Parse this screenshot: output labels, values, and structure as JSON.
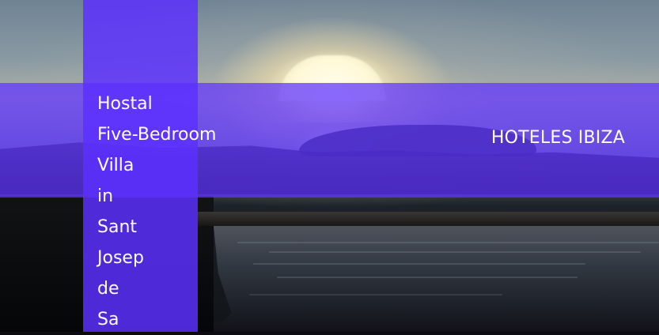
{
  "hero": {
    "title": "Hostal Five-Bedroom Villa in Sant Josep de Sa",
    "brand": "HOTELES IBIZA"
  },
  "colors": {
    "accent": "#6034FF",
    "text": "#FFFFFF"
  }
}
